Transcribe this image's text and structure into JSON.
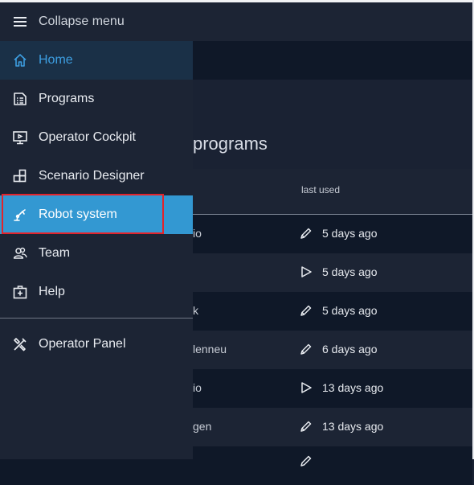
{
  "colors": {
    "accent": "#3398d2",
    "home_active": "#3d9ee1",
    "highlight": "#e3232a",
    "drawer_bg": "#1c2434",
    "row_dark": "#0f1828"
  },
  "drawer": {
    "collapse": {
      "label": "Collapse menu",
      "icon": "menu-icon"
    },
    "items": [
      {
        "label": "Home",
        "icon": "home-icon",
        "state": "active"
      },
      {
        "label": "Programs",
        "icon": "list-icon"
      },
      {
        "label": "Operator Cockpit",
        "icon": "monitor-icon"
      },
      {
        "label": "Scenario Designer",
        "icon": "blocks-icon"
      },
      {
        "label": "Robot system",
        "icon": "robot-arm-icon",
        "state": "selected"
      },
      {
        "label": "Team",
        "icon": "team-icon"
      },
      {
        "label": "Help",
        "icon": "first-aid-icon"
      }
    ],
    "footer_items": [
      {
        "label": "Operator Panel",
        "icon": "tools-icon"
      }
    ]
  },
  "main": {
    "title_partial": "programs",
    "table": {
      "column_last_used": "last used",
      "rows": [
        {
          "name_partial": "io",
          "action_icon": "pencil-icon",
          "last_used": "5 days ago"
        },
        {
          "name_partial": "",
          "action_icon": "play-icon",
          "last_used": "5 days ago"
        },
        {
          "name_partial": "k",
          "action_icon": "pencil-icon",
          "last_used": "5 days ago"
        },
        {
          "name_partial": "lenneu",
          "action_icon": "pencil-icon",
          "last_used": "6 days ago"
        },
        {
          "name_partial": "io",
          "action_icon": "play-icon",
          "last_used": "13 days ago"
        },
        {
          "name_partial": "gen",
          "action_icon": "pencil-icon",
          "last_used": "13 days ago"
        }
      ]
    }
  }
}
